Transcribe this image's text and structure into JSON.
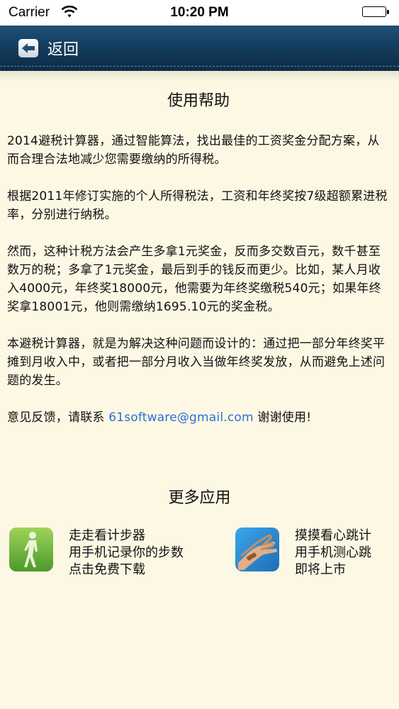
{
  "status_bar": {
    "carrier": "Carrier",
    "time": "10:20 PM"
  },
  "nav": {
    "back_label": "返回"
  },
  "help": {
    "title": "使用帮助",
    "paragraphs": [
      "2014避税计算器，通过智能算法，找出最佳的工资奖金分配方案，从而合理合法地减少您需要缴纳的所得税。",
      "根据2011年修订实施的个人所得税法，工资和年终奖按7级超额累进税率，分别进行纳税。",
      "然而，这种计税方法会产生多拿1元奖金，反而多交数百元，数千甚至数万的税；多拿了1元奖金，最后到手的钱反而更少。比如，某人月收入4000元，年终奖18000元，他需要为年终奖缴税540元；如果年终奖拿18001元，他则需缴纳1695.10元的奖金税。",
      "本避税计算器，就是为解决这种问题而设计的：通过把一部分年终奖平摊到月收入中，或者把一部分月收入当做年终奖发放，从而避免上述问题的发生。"
    ],
    "feedback_prefix": "意见反馈，请联系 ",
    "feedback_email": "61software@gmail.com",
    "feedback_suffix": " 谢谢使用!"
  },
  "more_apps": {
    "title": "更多应用",
    "apps": [
      {
        "icon": "walking-woman-icon",
        "lines": [
          "走走看计步器",
          "用手机记录你的步数",
          "点击免费下载"
        ]
      },
      {
        "icon": "wrist-pulse-icon",
        "lines": [
          "摸摸看心跳计",
          "用手机测心跳",
          "即将上市"
        ]
      }
    ]
  },
  "colors": {
    "nav_bar": "#123a5a",
    "background": "#fdf8e4",
    "link": "#2a6fd6"
  }
}
